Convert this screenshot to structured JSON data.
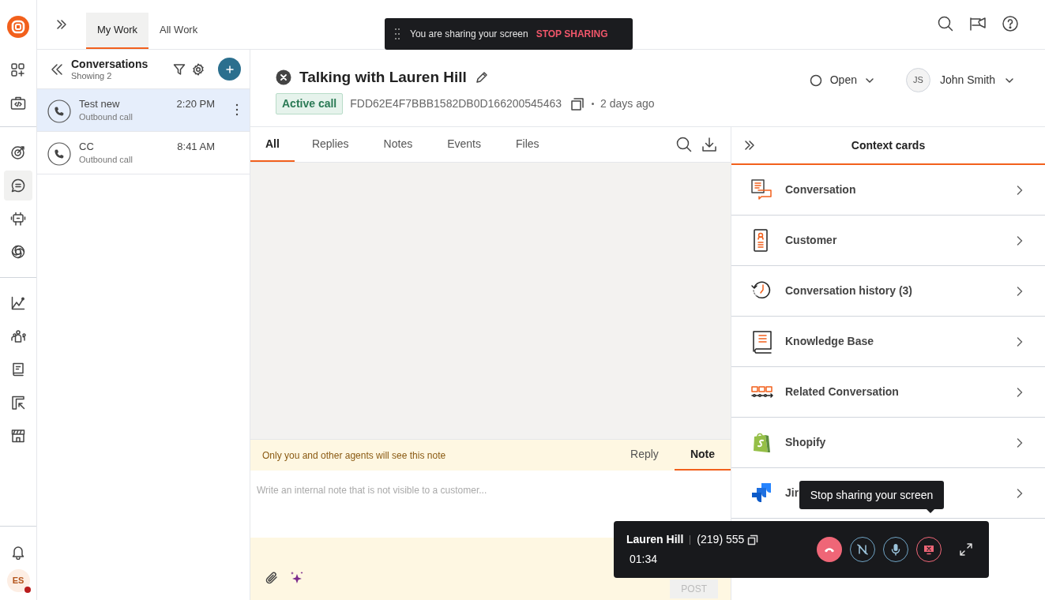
{
  "nav_rail": {
    "groups": [
      [
        {
          "kind": "apps",
          "selected": false
        },
        {
          "kind": "code",
          "selected": false
        }
      ],
      [
        {
          "kind": "target",
          "selected": false
        },
        {
          "kind": "chat",
          "selected": true
        },
        {
          "kind": "robot",
          "selected": false
        },
        {
          "kind": "aperture",
          "selected": false
        }
      ],
      [
        {
          "kind": "chart",
          "selected": false
        },
        {
          "kind": "people",
          "selected": false
        },
        {
          "kind": "book",
          "selected": false
        },
        {
          "kind": "import",
          "selected": false
        },
        {
          "kind": "store",
          "selected": false
        }
      ]
    ],
    "user": {
      "initials": "ES",
      "color": "#b91c1c"
    }
  },
  "top_tabs": [
    {
      "label": "My Work",
      "selected": true
    },
    {
      "label": "All Work",
      "selected": false
    }
  ],
  "share_banner": {
    "text": "You are sharing your screen",
    "action": "STOP SHARING"
  },
  "conversations": {
    "title": "Conversations",
    "subtitle": "Showing 2",
    "items": [
      {
        "name": "Test new",
        "type": "Outbound call",
        "time": "2:20 PM",
        "selected": true
      },
      {
        "name": "CC",
        "type": "Outbound call",
        "time": "8:41 AM",
        "selected": false
      }
    ]
  },
  "conversation": {
    "title": "Talking with Lauren Hill",
    "badge": "Active call",
    "id": "FDD62E4F7BBB1582DB0D166200545463",
    "age": "2 days ago",
    "status": "Open",
    "assignee": {
      "initials": "JS",
      "name": "John Smith"
    }
  },
  "timeline_tabs": [
    {
      "label": "All",
      "selected": true
    },
    {
      "label": "Replies",
      "selected": false
    },
    {
      "label": "Notes",
      "selected": false
    },
    {
      "label": "Events",
      "selected": false
    },
    {
      "label": "Files",
      "selected": false
    }
  ],
  "composer": {
    "notice": "Only you and other agents will see this note",
    "tabs": [
      {
        "label": "Reply",
        "selected": false
      },
      {
        "label": "Note",
        "selected": true
      }
    ],
    "placeholder": "Write an internal note that is not visible to a customer...",
    "post": "POST"
  },
  "context_cards": {
    "title": "Context cards",
    "items": [
      {
        "kind": "conversation",
        "label": "Conversation"
      },
      {
        "kind": "customer",
        "label": "Customer"
      },
      {
        "kind": "history",
        "label": "Conversation history (3)"
      },
      {
        "kind": "knowledge",
        "label": "Knowledge Base"
      },
      {
        "kind": "related",
        "label": "Related Conversation"
      },
      {
        "kind": "shopify",
        "label": "Shopify"
      },
      {
        "kind": "jira",
        "label": "Jir"
      }
    ]
  },
  "call_widget": {
    "name": "Lauren Hill",
    "phone": "(219) 555",
    "timer": "01:34",
    "tooltip": "Stop sharing your screen"
  }
}
